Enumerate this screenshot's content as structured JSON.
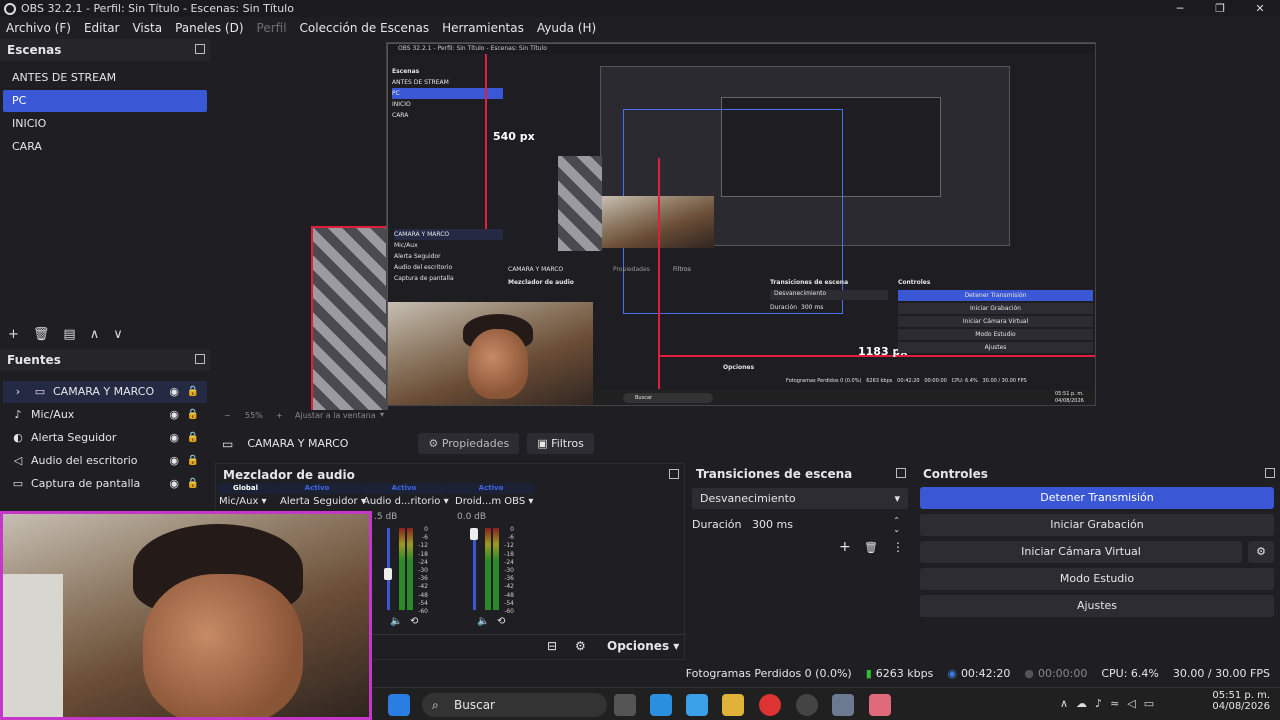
{
  "window": {
    "title": "OBS 32.2.1 - Perfil: Sin Título - Escenas: Sin Título",
    "minimize": "─",
    "maximize": "❐",
    "close": "✕"
  },
  "menu": [
    "Archivo (F)",
    "Editar",
    "Vista",
    "Paneles (D)",
    "Perfil",
    "Colección de Escenas",
    "Herramientas",
    "Ayuda (H)"
  ],
  "scenes": {
    "title": "Escenas",
    "items": [
      "ANTES DE STREAM",
      "PC",
      "INICIO",
      "CARA"
    ],
    "selected": "PC"
  },
  "sources": {
    "title": "Fuentes",
    "items": [
      {
        "label": "CAMARA Y MARCO",
        "icon": "folder-icon"
      },
      {
        "label": "Mic/Aux",
        "icon": "mic-icon"
      },
      {
        "label": "Alerta Seguidor",
        "icon": "browser-icon"
      },
      {
        "label": "Audio del escritorio",
        "icon": "speaker-icon"
      },
      {
        "label": "Captura de pantalla",
        "icon": "monitor-icon"
      }
    ]
  },
  "preview": {
    "label_height": "540 px",
    "label_width": "1183 px",
    "zoom": "55%",
    "fit": "Ajustar a la ventana"
  },
  "nested": {
    "title": "OBS 32.2.1 - Perfil: Sin Título - Escenas: Sin Título",
    "mixer_title": "Mezclador de audio",
    "trans_title": "Transiciones de escena",
    "controls_title": "Controles",
    "trans_value": "Desvanecimiento",
    "duration_label": "Duración",
    "duration_value": "300 ms",
    "btn_stop": "Detener Transmisión",
    "btn_rec": "Iniciar Grabación",
    "btn_vcam": "Iniciar Cámara Virtual",
    "btn_studio": "Modo Estudio",
    "btn_settings": "Ajustes",
    "options": "Opciones",
    "props": "Propiedades",
    "filters": "Filtros",
    "cam": "CAMARA Y MARCO",
    "search": "Buscar",
    "status": "Fotogramas Perdidos 0 (0.0%)   6263 kbps   00:42:20   00:00:00   CPU: 6.4%   30.00 / 30.00 FPS",
    "time": "05:51 p. m.",
    "date": "04/08/2026",
    "size_label": "1183 px"
  },
  "props_bar": {
    "current": "CAMARA Y MARCO",
    "properties": "Propiedades",
    "filters": "Filtros"
  },
  "mixer": {
    "title": "Mezclador de audio",
    "tabs": [
      "Global",
      "Activo",
      "Activo",
      "Activo"
    ],
    "channels": [
      "Mic/Aux",
      "Alerta Seguidor",
      "Audio d...ritorio",
      "Droid...m OBS"
    ],
    "db_left": ".5 dB",
    "db_right": "0.0 dB",
    "ticks": [
      "0",
      "-6",
      "-12",
      "-18",
      "-24",
      "-30",
      "-36",
      "-42",
      "-48",
      "-54",
      "-60"
    ],
    "options": "Opciones"
  },
  "transitions": {
    "title": "Transiciones de escena",
    "value": "Desvanecimiento",
    "duration_label": "Duración",
    "duration_value": "300 ms"
  },
  "controls": {
    "title": "Controles",
    "buttons": [
      "Detener Transmisión",
      "Iniciar Grabación",
      "Iniciar Cámara Virtual",
      "Modo Estudio",
      "Ajustes"
    ]
  },
  "status": {
    "dropped": "Fotogramas Perdidos 0 (0.0%)",
    "bitrate": "6263 kbps",
    "stream_time": "00:42:20",
    "rec_time": "00:00:00",
    "cpu": "CPU: 6.4%",
    "fps": "30.00 / 30.00 FPS"
  },
  "taskbar": {
    "search": "Buscar",
    "time": "05:51 p. m.",
    "date": "04/08/2026"
  },
  "colors": {
    "accent": "#3a58d6",
    "guide_red": "#e01f3a",
    "frame_magenta": "#c437c9"
  }
}
